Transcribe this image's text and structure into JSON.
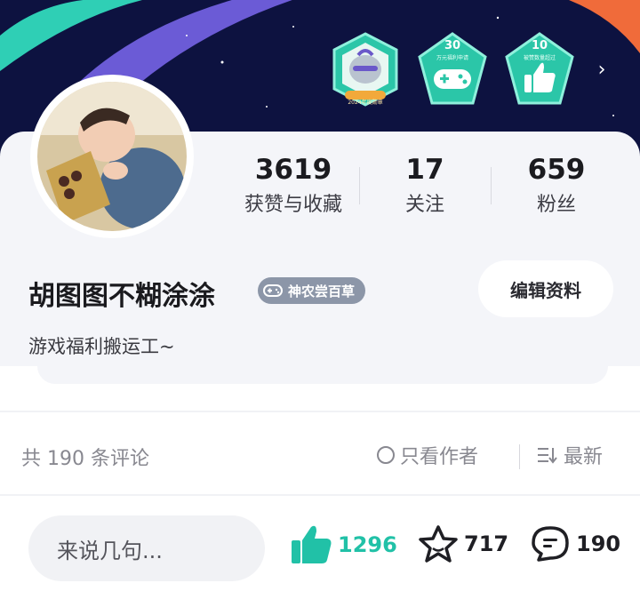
{
  "colors": {
    "banner_bg": "#0d1240",
    "accent_teal": "#21c1a7",
    "card_bg": "#f4f5f9"
  },
  "header": {
    "badges": [
      {
        "icon": "knight-helmet-badge-icon",
        "label": "2024年度勋章"
      },
      {
        "icon": "gamepad-badge-icon",
        "number": "30",
        "sub": "万元福利申请"
      },
      {
        "icon": "thumbs-up-badge-icon",
        "number": "10",
        "sub": "被赞数量超过"
      }
    ],
    "more_icon": "chevron-right-icon"
  },
  "profile": {
    "stats": [
      {
        "value": "3619",
        "label": "获赞与收藏"
      },
      {
        "value": "17",
        "label": "关注"
      },
      {
        "value": "659",
        "label": "粉丝"
      }
    ],
    "name": "胡图图不糊涂涂",
    "level_badge": "神农尝百草",
    "edit_button": "编辑资料",
    "bio": "游戏福利搬运工~"
  },
  "comments": {
    "count_text": "共 190 条评论",
    "only_author": "只看作者",
    "sort_label": "最新"
  },
  "bottom_bar": {
    "input_placeholder": "来说几句...",
    "likes": "1296",
    "favorites": "717",
    "comments": "190"
  }
}
